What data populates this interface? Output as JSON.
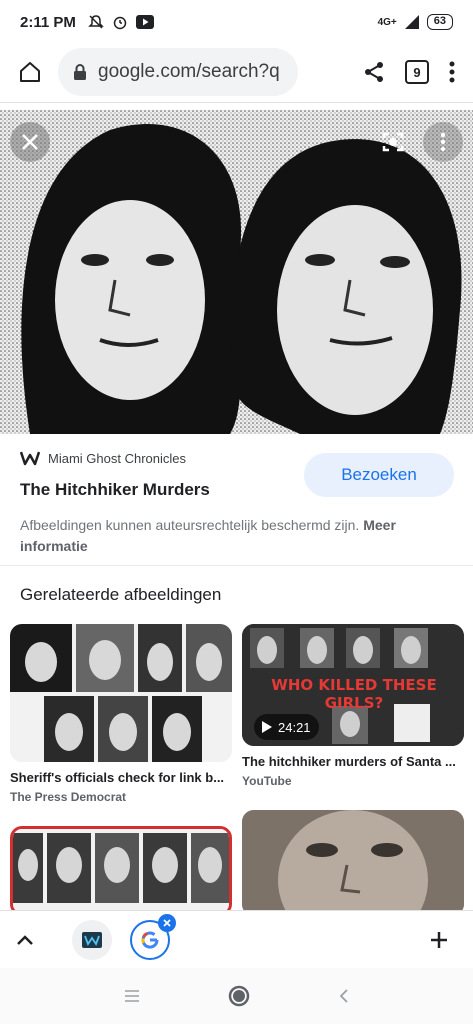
{
  "status_bar": {
    "time": "2:11 PM",
    "network": "4G+",
    "battery": "63"
  },
  "toolbar": {
    "url": "google.com/search?q",
    "tab_count": "9"
  },
  "hero": {
    "close_label": "close",
    "more_label": "more"
  },
  "source": {
    "site_name": "Miami Ghost Chronicles",
    "title": "The Hitchhiker Murders",
    "visit_label": "Bezoeken"
  },
  "copyright": {
    "text": "Afbeeldingen kunnen auteursrechtelijk beschermd zijn.",
    "more_link": "Meer informatie"
  },
  "related": {
    "heading": "Gerelateerde afbeeldingen",
    "cards": [
      {
        "title": "Sheriff's officials check for link b...",
        "source": "The Press Democrat"
      },
      {
        "title": "The hitchhiker murders of Santa ...",
        "source": "YouTube",
        "duration": "24:21",
        "overlay_text": "WHO KILLED THESE GIRLS?"
      }
    ]
  },
  "colors": {
    "accent": "#1a73e8",
    "visit_bg": "#e8f0fe",
    "youtube_red": "#e53935"
  },
  "icons": [
    "home-icon",
    "lock-icon",
    "share-icon",
    "tabs-icon",
    "more-vert-icon",
    "close-icon",
    "lens-icon",
    "chevron-up-icon",
    "plus-icon"
  ]
}
